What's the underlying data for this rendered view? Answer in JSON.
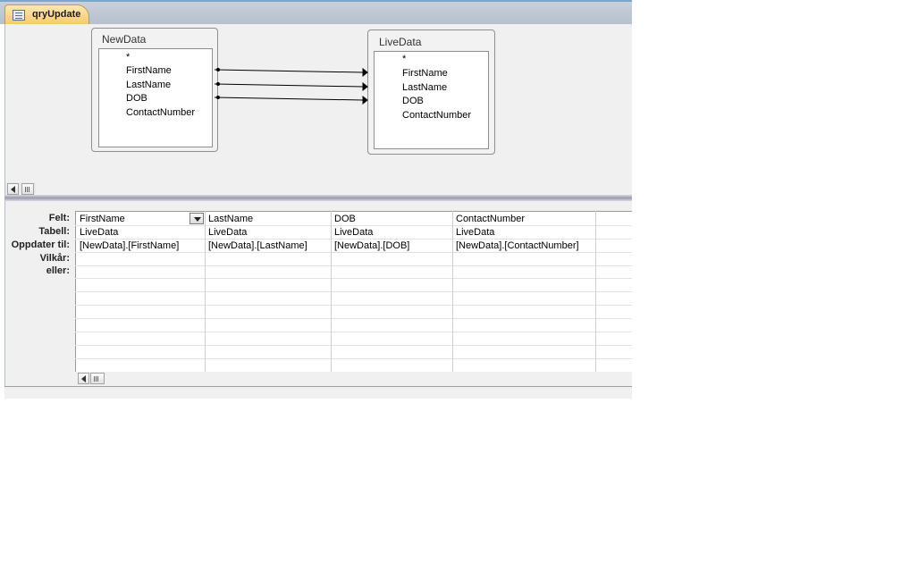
{
  "document_tab": {
    "label": "qryUpdate",
    "icon": "query-icon"
  },
  "tables": [
    {
      "name": "NewData",
      "fields": [
        "*",
        "FirstName",
        "LastName",
        "DOB",
        "ContactNumber"
      ]
    },
    {
      "name": "LiveData",
      "fields": [
        "*",
        "FirstName",
        "LastName",
        "DOB",
        "ContactNumber"
      ]
    }
  ],
  "joins": [
    {
      "from": "NewData.FirstName",
      "to": "LiveData.FirstName"
    },
    {
      "from": "NewData.LastName",
      "to": "LiveData.LastName"
    },
    {
      "from": "NewData.DOB",
      "to": "LiveData.DOB"
    }
  ],
  "grid": {
    "row_labels": [
      "Felt:",
      "Tabell:",
      "Oppdater til:",
      "Vilkår:",
      "eller:"
    ],
    "columns": [
      {
        "field": "FirstName",
        "table": "LiveData",
        "update_to": "[NewData].[FirstName]"
      },
      {
        "field": "LastName",
        "table": "LiveData",
        "update_to": "[NewData].[LastName]"
      },
      {
        "field": "DOB",
        "table": "LiveData",
        "update_to": "[NewData].[DOB]"
      },
      {
        "field": "ContactNumber",
        "table": "LiveData",
        "update_to": "[NewData].[ContactNumber]"
      }
    ]
  }
}
